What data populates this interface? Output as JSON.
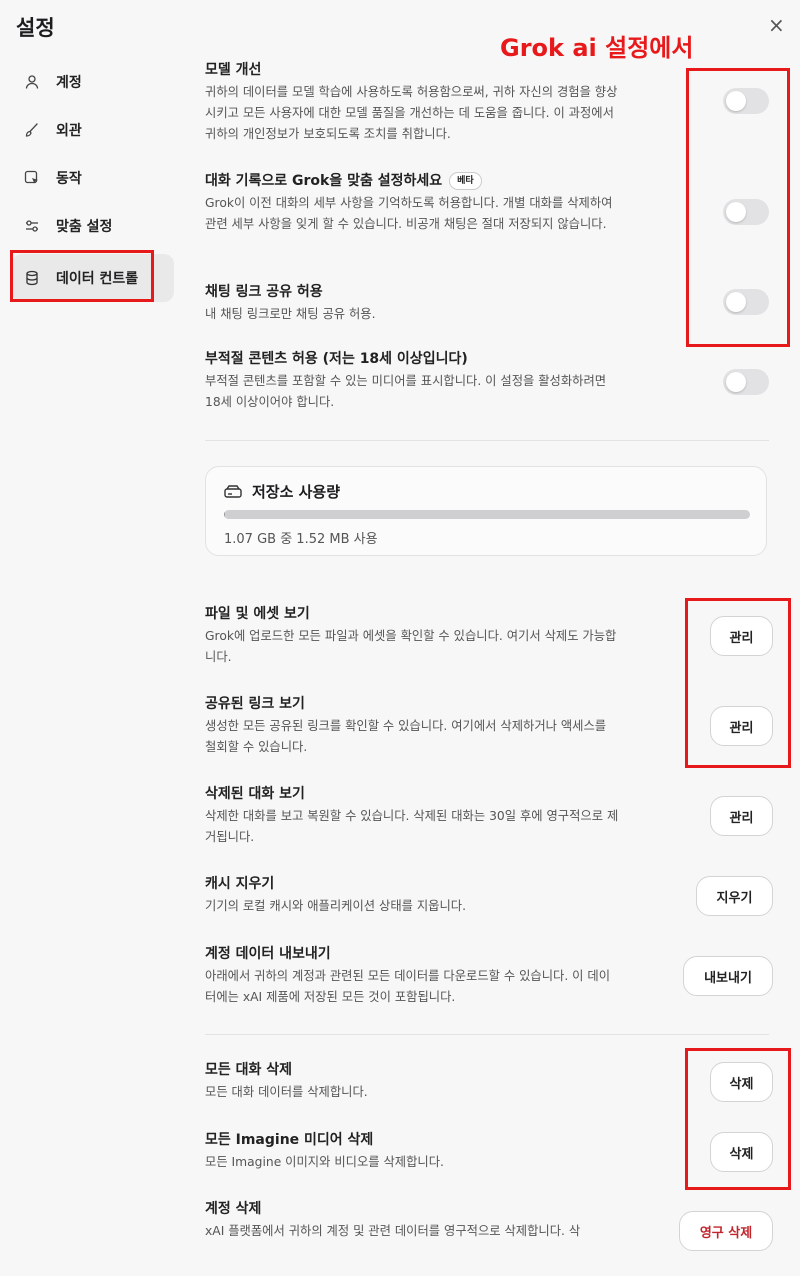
{
  "header": {
    "title": "설정",
    "close_label": "×"
  },
  "annotation": {
    "text": "Grok ai 설정에서"
  },
  "sidebar": {
    "items": [
      {
        "label": "계정",
        "icon": "user-icon"
      },
      {
        "label": "외관",
        "icon": "brush-icon"
      },
      {
        "label": "동작",
        "icon": "cursor-icon"
      },
      {
        "label": "맞춤 설정",
        "icon": "sliders-icon"
      },
      {
        "label": "데이터 컨트롤",
        "icon": "database-icon",
        "active": true
      }
    ]
  },
  "settings": {
    "model_improve": {
      "title": "모델 개선",
      "desc": "귀하의 데이터를 모델 학습에 사용하도록 허용함으로써, 귀하 자신의 경험을 향상시키고 모든 사용자에 대한 모델 품질을 개선하는 데 도움을 줍니다. 이 과정에서 귀하의 개인정보가 보호되도록 조치를 취합니다.",
      "enabled": false
    },
    "personalize": {
      "title": "대화 기록으로 Grok을 맞춤 설정하세요",
      "badge": "베타",
      "desc": "Grok이 이전 대화의 세부 사항을 기억하도록 허용합니다. 개별 대화를 삭제하여 관련 세부 사항을 잊게 할 수 있습니다. 비공개 채팅은 절대 저장되지 않습니다.",
      "enabled": false
    },
    "share_links": {
      "title": "채팅 링크 공유 허용",
      "desc": "내 채팅 링크로만 채팅 공유 허용.",
      "enabled": false
    },
    "nsfw": {
      "title": "부적절 콘텐츠 허용 (저는 18세 이상입니다)",
      "desc": "부적절 콘텐츠를 포함할 수 있는 미디어를 표시합니다. 이 설정을 활성화하려면 18세 이상이어야 합니다.",
      "enabled": false
    }
  },
  "storage": {
    "title": "저장소 사용량",
    "usage_text": "1.07 GB 중 1.52 MB 사용",
    "fraction": 0.0014
  },
  "actions": {
    "files": {
      "title": "파일 및 에셋 보기",
      "desc": "Grok에 업로드한 모든 파일과 에셋을 확인할 수 있습니다. 여기서 삭제도 가능합니다.",
      "button": "관리"
    },
    "shared_links": {
      "title": "공유된 링크 보기",
      "desc": "생성한 모든 공유된 링크를 확인할 수 있습니다. 여기에서 삭제하거나 액세스를 철회할 수 있습니다.",
      "button": "관리"
    },
    "deleted_chats": {
      "title": "삭제된 대화 보기",
      "desc": "삭제한 대화를 보고 복원할 수 있습니다. 삭제된 대화는 30일 후에 영구적으로 제거됩니다.",
      "button": "관리"
    },
    "clear_cache": {
      "title": "캐시 지우기",
      "desc": "기기의 로컬 캐시와 애플리케이션 상태를 지웁니다.",
      "button": "지우기"
    },
    "export": {
      "title": "계정 데이터 내보내기",
      "desc": "아래에서 귀하의 계정과 관련된 모든 데이터를 다운로드할 수 있습니다. 이 데이터에는 xAI 제품에 저장된 모든 것이 포함됩니다.",
      "button": "내보내기"
    },
    "delete_chats": {
      "title": "모든 대화 삭제",
      "desc": "모든 대화 데이터를 삭제합니다.",
      "button": "삭제"
    },
    "delete_imagine": {
      "title": "모든 Imagine 미디어 삭제",
      "desc": "모든 Imagine 이미지와 비디오를 삭제합니다.",
      "button": "삭제"
    },
    "delete_account": {
      "title": "계정 삭제",
      "desc": "xAI 플랫폼에서 귀하의 계정 및 관련 데이터를 영구적으로 삭제합니다. 삭",
      "button": "영구 삭제"
    }
  },
  "colors": {
    "annotation": "#e8191b",
    "danger": "#c0262d",
    "toggle_off": "#e2e2e4"
  }
}
